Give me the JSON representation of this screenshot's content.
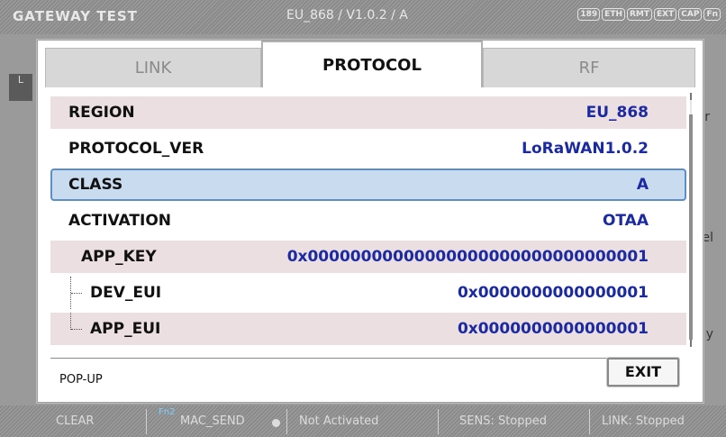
{
  "topbar": {
    "title": "GATEWAY TEST",
    "mode": "EU_868 / V1.0.2 / A",
    "badges": [
      "189",
      "ETH",
      "RMT",
      "EXT",
      "CAP",
      "Fn"
    ]
  },
  "background": {
    "left_label": "L",
    "right_stub_1": "r",
    "right_stub_2": "el",
    "right_stub_3": "y"
  },
  "tabs": [
    {
      "label": "LINK",
      "active": false
    },
    {
      "label": "PROTOCOL",
      "active": true
    },
    {
      "label": "RF",
      "active": false
    }
  ],
  "rows": [
    {
      "label": "REGION",
      "value": "EU_868"
    },
    {
      "label": "PROTOCOL_VER",
      "value": "LoRaWAN1.0.2"
    },
    {
      "label": "CLASS",
      "value": "A",
      "selected": true
    },
    {
      "label": "ACTIVATION",
      "value": "OTAA"
    },
    {
      "label": "APP_KEY",
      "value": "0x00000000000000000000000000000001"
    },
    {
      "label": "DEV_EUI",
      "value": "0x0000000000000001"
    },
    {
      "label": "APP_EUI",
      "value": "0x0000000000000001"
    }
  ],
  "footer": {
    "popup_label": "POP-UP",
    "exit_label": "EXIT"
  },
  "bottombar": {
    "clear": "CLEAR",
    "fn2": "Fn2",
    "mac_send": "MAC_SEND",
    "status": "Not Activated",
    "sens": "SENS: Stopped",
    "link": "LINK: Stopped"
  }
}
